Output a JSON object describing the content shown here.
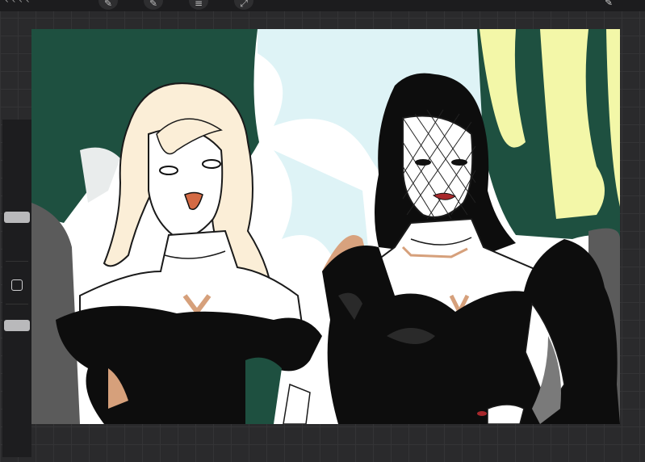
{
  "app": {
    "top_toolbar": {
      "left_label": "‹ ‹ ‹ ‹",
      "tools": [
        "brush-icon",
        "smudge-icon",
        "eraser-icon",
        "layers-icon"
      ],
      "right_icon": "color-icon"
    },
    "sidebar": {
      "brush_size_level": 0.55,
      "opacity_level": 0.1,
      "modify_button_icon": "square-icon"
    },
    "canvas": {
      "subject": "illustration",
      "colors": {
        "hedge_dark": "#1e5040",
        "hedge_yellow": "#f3f7a8",
        "sky": "#def3f6",
        "hair_blonde": "#fbeed7",
        "skin": "#ffffff",
        "dress": "#0d0d0d",
        "lip": "#d46a44",
        "lip_red": "#a8282c",
        "skin_shadow": "#d6a07b",
        "background_gray": "#5b5b5b"
      }
    }
  }
}
